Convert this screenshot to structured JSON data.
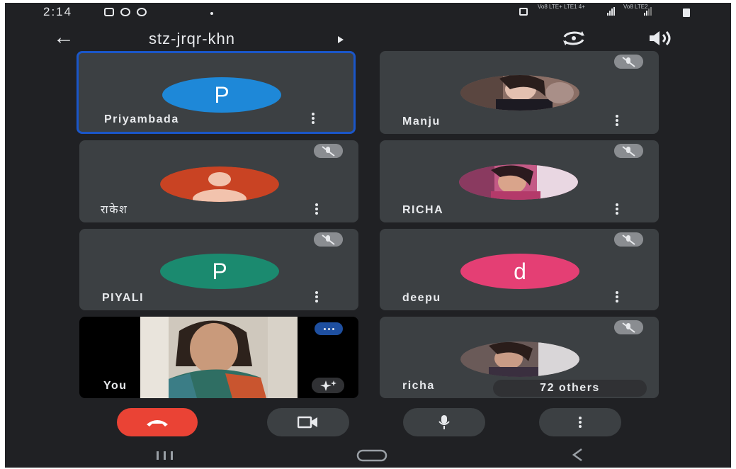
{
  "status_bar": {
    "time": "2:14",
    "carrier_1": "Vo8 LTE+ LTE1 4+",
    "carrier_2": "Vo8 LTE2",
    "icons": [
      "gallery-icon",
      "whatsapp-icon",
      "b-icon",
      "camera-icon",
      "signal-icon",
      "battery-icon"
    ]
  },
  "header": {
    "meeting_code": "stz-jrqr-khn",
    "icons": [
      "back-arrow-icon",
      "caret-right-icon",
      "switch-camera-icon",
      "speaker-icon"
    ]
  },
  "participants": [
    {
      "name": "Priyambada",
      "avatar_letter": "P",
      "avatar_color": "#1e88d8",
      "muted": false,
      "active": true
    },
    {
      "name": "Manju",
      "avatar_letter": "",
      "avatar_color": "",
      "muted": true,
      "active": false
    },
    {
      "name": "राकेश",
      "avatar_letter": "",
      "avatar_color": "#c94323",
      "muted": true,
      "active": false
    },
    {
      "name": "RICHA",
      "avatar_letter": "",
      "avatar_color": "",
      "muted": true,
      "active": false
    },
    {
      "name": "PIYALI",
      "avatar_letter": "P",
      "avatar_color": "#1b8a6f",
      "muted": true,
      "active": false
    },
    {
      "name": "deepu",
      "avatar_letter": "d",
      "avatar_color": "#e43f74",
      "muted": true,
      "active": false
    },
    {
      "name": "You",
      "avatar_letter": "",
      "avatar_color": "",
      "muted": false,
      "active": false
    },
    {
      "name": "richa",
      "avatar_letter": "",
      "avatar_color": "",
      "muted": true,
      "active": false
    }
  ],
  "others": {
    "label": "72 others"
  },
  "controls": {
    "icons": [
      "end-call-icon",
      "video-camera-icon",
      "microphone-icon",
      "more-options-icon"
    ],
    "end_call_color": "#ea4335"
  },
  "nav_bar": {
    "icons": [
      "recent-apps-icon",
      "home-icon",
      "back-icon"
    ]
  },
  "colors": {
    "background": "#202124",
    "tile": "#3c4043",
    "active_border": "#1a56c8",
    "muted_badge": "#8a8d91"
  }
}
